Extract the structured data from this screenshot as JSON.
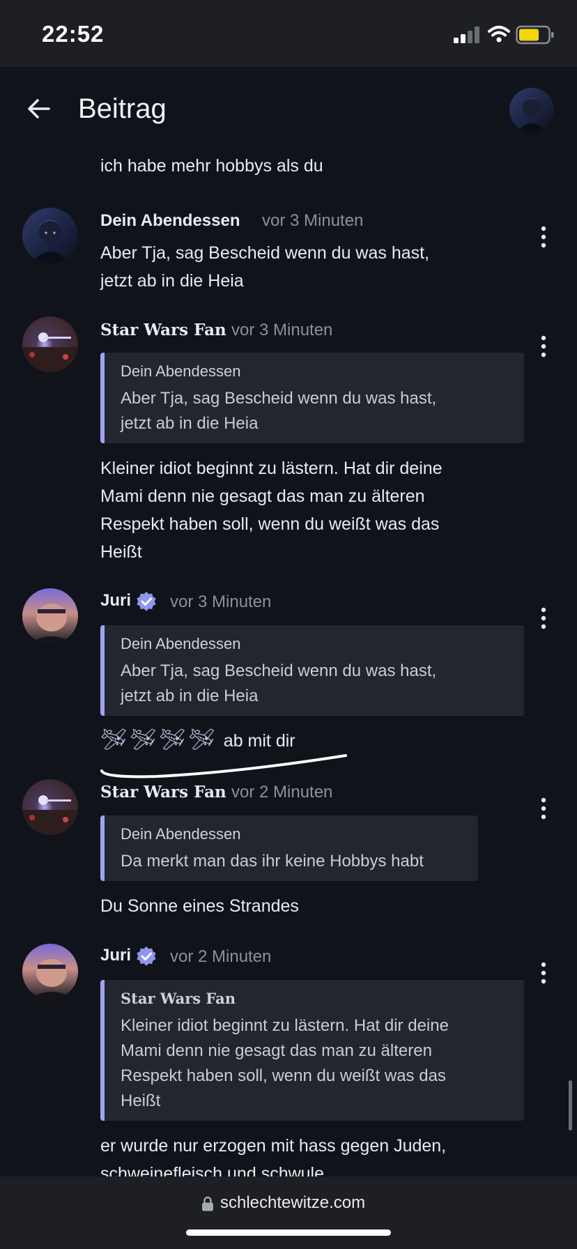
{
  "status_bar": {
    "time": "22:52",
    "battery_color": "#f5d40a"
  },
  "header": {
    "title": "Beitrag"
  },
  "feed": {
    "top_line": "ich habe mehr hobbys als du",
    "comments": [
      {
        "author": "Dein Abendessen",
        "time": "vor 3 Minuten",
        "body": [
          "Aber Tja, sag Bescheid wenn du was hast,",
          "jetzt ab in die Heia"
        ]
      },
      {
        "author": "Star Wars Fan",
        "time": "vor 3 Minuten",
        "quote": {
          "author": "Dein Abendessen",
          "lines": [
            "Aber Tja, sag Bescheid wenn du was hast,",
            "jetzt ab in die Heia"
          ]
        },
        "body": [
          "Kleiner idiot beginnt zu lästern. Hat dir deine",
          "Mami denn nie gesagt das man zu älteren",
          "Respekt haben soll, wenn du weißt was das",
          "Heißt"
        ]
      },
      {
        "author": "Juri",
        "verified": true,
        "time": "vor 3 Minuten",
        "quote": {
          "author": "Dein Abendessen",
          "lines": [
            "Aber Tja, sag Bescheid wenn du was hast,",
            "jetzt ab in die Heia"
          ]
        },
        "emoji": "🛩🛩🛩🛩",
        "body_text": "ab mit dir"
      },
      {
        "author": "Star Wars Fan",
        "time": "vor 2 Minuten",
        "quote": {
          "author": "Dein Abendessen",
          "lines": [
            "Da merkt man das ihr keine Hobbys habt"
          ]
        },
        "body": [
          "Du Sonne eines Strandes"
        ]
      },
      {
        "author": "Juri",
        "verified": true,
        "time": "vor 2 Minuten",
        "quote": {
          "author": "Star Wars Fan",
          "lines": [
            "Kleiner idiot beginnt zu lästern. Hat dir deine",
            "Mami denn nie gesagt das man zu älteren",
            "Respekt haben soll, wenn du weißt was das",
            "Heißt"
          ]
        },
        "body": [
          "er wurde nur erzogen mit hass gegen Juden,",
          "schweinefleisch und schwule"
        ]
      }
    ]
  },
  "bottom_bar": {
    "url": "schlechtewitze.com"
  },
  "icons": {
    "back": "arrow-left-icon",
    "verified": "verified-badge-icon",
    "more": "more-vertical-icon",
    "lock": "lock-icon"
  },
  "colors": {
    "accent_quote_border": "#9fa4f1",
    "verified_badge": "#8e95f0",
    "background": "#11131b",
    "muted_text": "#8d909b"
  }
}
